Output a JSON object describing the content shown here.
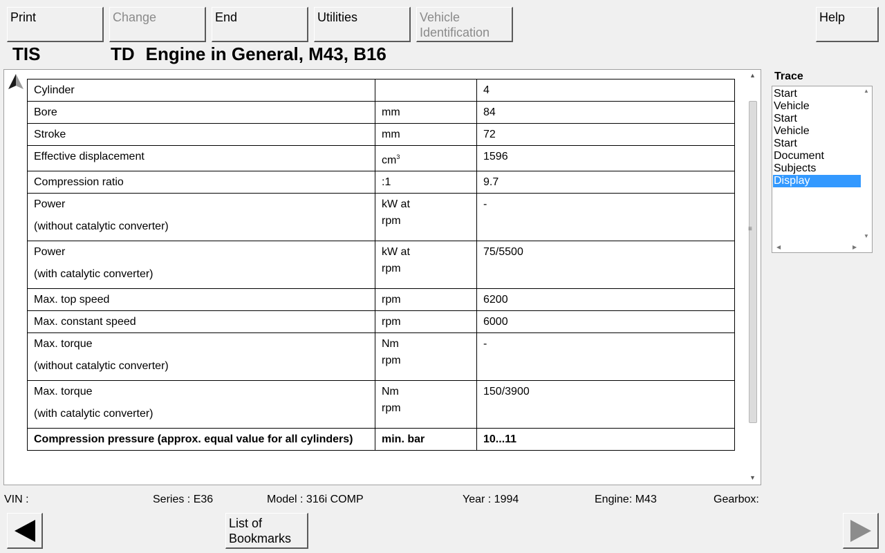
{
  "toolbar": {
    "print": "Print",
    "change": "Change",
    "end": "End",
    "utilities": "Utilities",
    "vehicle_id_line1": "Vehicle",
    "vehicle_id_line2": "Identification",
    "help": "Help"
  },
  "header": {
    "app_name": "TIS",
    "doc_code": "TD",
    "doc_title": "Engine in General, M43, B16"
  },
  "table": {
    "rows": [
      {
        "label": "Cylinder",
        "unit": "",
        "value": "4"
      },
      {
        "label": "Bore",
        "unit": "mm",
        "value": "84"
      },
      {
        "label": "Stroke",
        "unit": "mm",
        "value": "72"
      },
      {
        "label": "Effective displacement",
        "unit": "cm",
        "unit_sup": "3",
        "value": "1596"
      },
      {
        "label": "Compression ratio",
        "unit": ":1",
        "value": "9.7"
      },
      {
        "label": "Power",
        "sublabel": "(without catalytic converter)",
        "unit": "kW at",
        "unit2": "rpm",
        "value": "-"
      },
      {
        "label": "Power",
        "sublabel": "(with catalytic converter)",
        "unit": "kW at",
        "unit2": "rpm",
        "value": "75/5500"
      },
      {
        "label": "Max. top speed",
        "unit": "rpm",
        "value": "6200"
      },
      {
        "label": "Max. constant speed",
        "unit": "rpm",
        "value": "6000"
      },
      {
        "label": "Max. torque",
        "sublabel": "(without catalytic converter)",
        "unit": "Nm",
        "unit2": "rpm",
        "value": "-"
      },
      {
        "label": "Max. torque",
        "sublabel": "(with catalytic converter)",
        "unit": "Nm",
        "unit2": "rpm",
        "value": "150/3900"
      },
      {
        "label": "Compression pressure (approx. equal value for all cylinders)",
        "unit": "min. bar",
        "value": "10...11"
      }
    ]
  },
  "trace": {
    "label": "Trace",
    "items": [
      "Start",
      "Vehicle",
      "Start",
      "Vehicle",
      "Start",
      "Document",
      "Subjects",
      "Display"
    ],
    "selected": "Display"
  },
  "status": {
    "vin": "VIN :",
    "series": "Series : E36",
    "model": "Model : 316i COMP",
    "year": "Year : 1994",
    "engine": "Engine: M43",
    "gearbox": "Gearbox:"
  },
  "nav": {
    "bookmarks_line1": "List of",
    "bookmarks_line2": "Bookmarks"
  },
  "colors": {
    "background": "#f0f0f0",
    "selection": "#3399ff",
    "disabled_text": "#8a8a8a"
  },
  "icons": {
    "back": "back-arrow-icon",
    "forward": "forward-arrow-icon",
    "up": "up-arrow-icon"
  }
}
